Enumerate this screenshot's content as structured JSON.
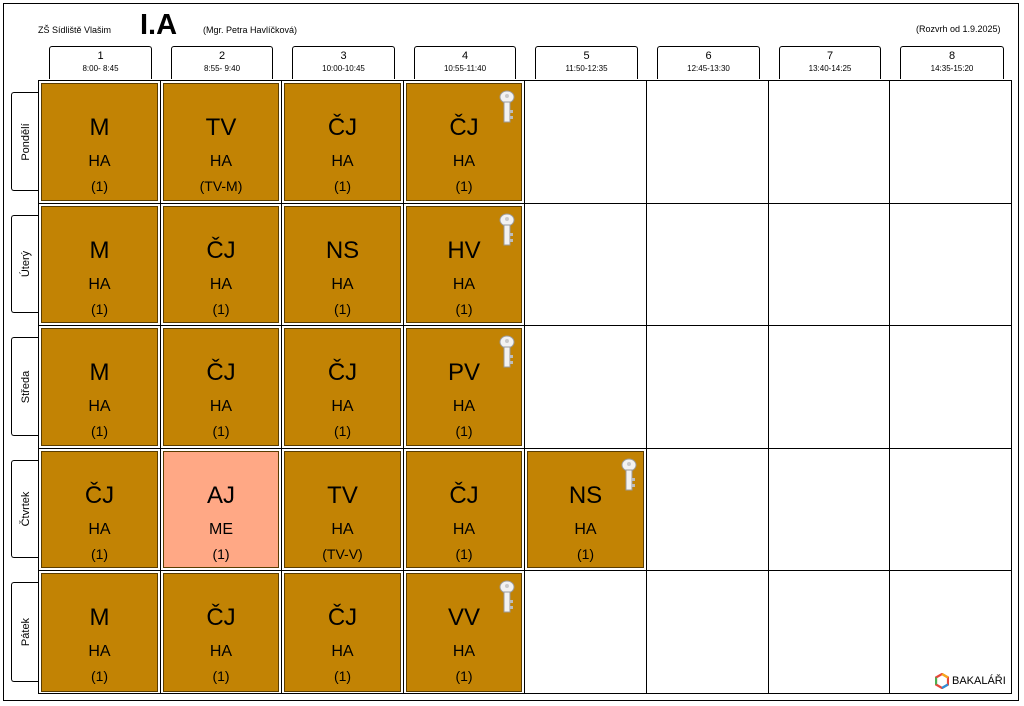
{
  "header": {
    "school": "ZŠ Sídliště Vlašim",
    "class_name": "I.A",
    "teacher": "(Mgr. Petra Havlíčková)",
    "valid_from": "(Rozvrh od 1.9.2025)"
  },
  "periods": [
    {
      "num": "1",
      "time": "8:00- 8:45"
    },
    {
      "num": "2",
      "time": "8:55- 9:40"
    },
    {
      "num": "3",
      "time": "10:00-10:45"
    },
    {
      "num": "4",
      "time": "10:55-11:40"
    },
    {
      "num": "5",
      "time": "11:50-12:35"
    },
    {
      "num": "6",
      "time": "12:45-13:30"
    },
    {
      "num": "7",
      "time": "13:40-14:25"
    },
    {
      "num": "8",
      "time": "14:35-15:20"
    }
  ],
  "days": [
    {
      "name": "Pondělí",
      "lessons": [
        {
          "subject": "M",
          "teacher": "HA",
          "group": "(1)"
        },
        {
          "subject": "TV",
          "teacher": "HA",
          "group": "(TV-M)"
        },
        {
          "subject": "ČJ",
          "teacher": "HA",
          "group": "(1)"
        },
        {
          "subject": "ČJ",
          "teacher": "HA",
          "group": "(1)",
          "key": true
        }
      ]
    },
    {
      "name": "Úterý",
      "lessons": [
        {
          "subject": "M",
          "teacher": "HA",
          "group": "(1)"
        },
        {
          "subject": "ČJ",
          "teacher": "HA",
          "group": "(1)"
        },
        {
          "subject": "NS",
          "teacher": "HA",
          "group": "(1)"
        },
        {
          "subject": "HV",
          "teacher": "HA",
          "group": "(1)",
          "key": true
        }
      ]
    },
    {
      "name": "Středa",
      "lessons": [
        {
          "subject": "M",
          "teacher": "HA",
          "group": "(1)"
        },
        {
          "subject": "ČJ",
          "teacher": "HA",
          "group": "(1)"
        },
        {
          "subject": "ČJ",
          "teacher": "HA",
          "group": "(1)"
        },
        {
          "subject": "PV",
          "teacher": "HA",
          "group": "(1)",
          "key": true
        }
      ]
    },
    {
      "name": "Čtvrtek",
      "lessons": [
        {
          "subject": "ČJ",
          "teacher": "HA",
          "group": "(1)"
        },
        {
          "subject": "AJ",
          "teacher": "ME",
          "group": "(1)",
          "color": "#ffa885"
        },
        {
          "subject": "TV",
          "teacher": "HA",
          "group": "(TV-V)"
        },
        {
          "subject": "ČJ",
          "teacher": "HA",
          "group": "(1)"
        },
        {
          "subject": "NS",
          "teacher": "HA",
          "group": "(1)",
          "key": true
        }
      ]
    },
    {
      "name": "Pátek",
      "lessons": [
        {
          "subject": "M",
          "teacher": "HA",
          "group": "(1)"
        },
        {
          "subject": "ČJ",
          "teacher": "HA",
          "group": "(1)"
        },
        {
          "subject": "ČJ",
          "teacher": "HA",
          "group": "(1)"
        },
        {
          "subject": "VV",
          "teacher": "HA",
          "group": "(1)",
          "key": true
        }
      ]
    }
  ],
  "colors": {
    "lesson": "#c28304",
    "english": "#ffa885"
  },
  "footer": {
    "brand": "BAKALÁŘI"
  },
  "icons": {
    "key": "key-icon",
    "logo": "bakalari-logo-icon"
  }
}
